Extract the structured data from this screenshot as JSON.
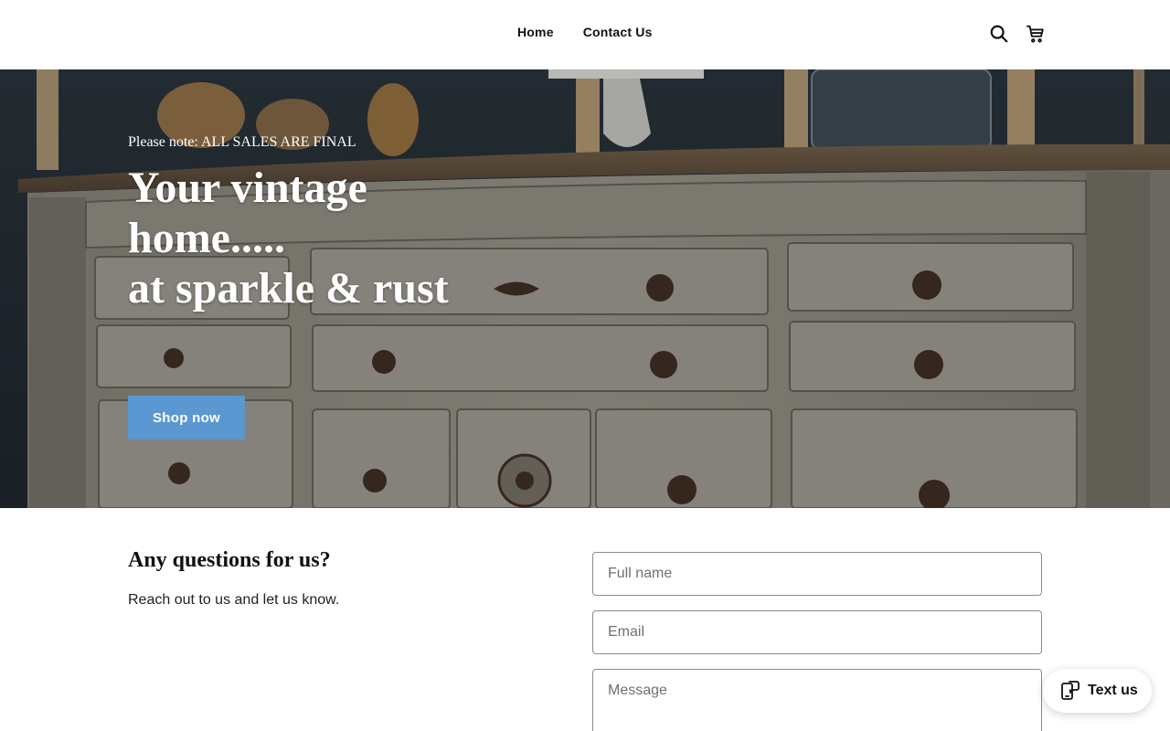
{
  "header": {
    "nav": [
      {
        "label": "Home"
      },
      {
        "label": "Contact Us"
      }
    ],
    "icons": {
      "search": "search-icon",
      "cart": "cart-icon"
    }
  },
  "hero": {
    "notice": "Please note: ALL SALES ARE FINAL",
    "headline_lines": [
      "Your vintage",
      "home.....",
      "at sparkle & rust"
    ],
    "cta_label": "Shop now",
    "colors": {
      "cta": "#5b97d0"
    }
  },
  "contact": {
    "title": "Any questions for us?",
    "subtitle": "Reach out to us and let us know.",
    "fields": {
      "name_placeholder": "Full name",
      "email_placeholder": "Email",
      "message_placeholder": "Message"
    }
  },
  "chat_widget": {
    "label": "Text us",
    "icon": "phone-chat-icon"
  }
}
